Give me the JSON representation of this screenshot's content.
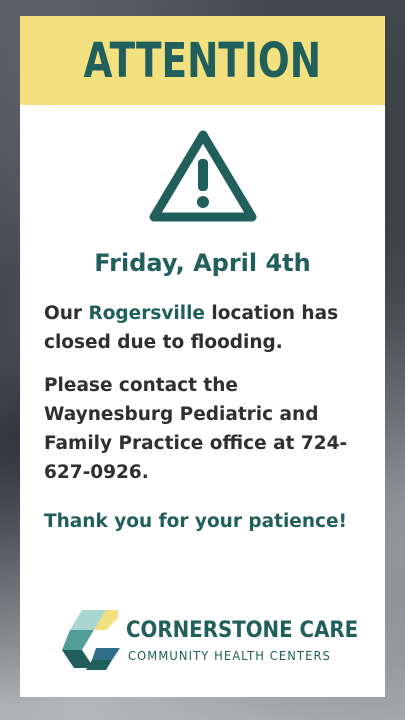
{
  "banner": {
    "title": "ATTENTION"
  },
  "icons": {
    "warning": "warning-triangle-icon",
    "logo": "cornerstone-logo-mark-icon"
  },
  "notice": {
    "date": "Friday, April 4th",
    "p1_prefix": "Our ",
    "p1_location": "Rogersville",
    "p1_suffix": " location has closed due to flooding.",
    "p2": "Please contact the Waynesburg Pediatric and Family Practice office at 724-627-0926.",
    "thanks": "Thank you for your patience!"
  },
  "logo": {
    "name": "CORNERSTONE CARE",
    "subtitle": "COMMUNITY HEALTH CENTERS"
  },
  "colors": {
    "teal": "#215f5d",
    "yellow": "#f2e17e",
    "text": "#2f2f2f"
  }
}
